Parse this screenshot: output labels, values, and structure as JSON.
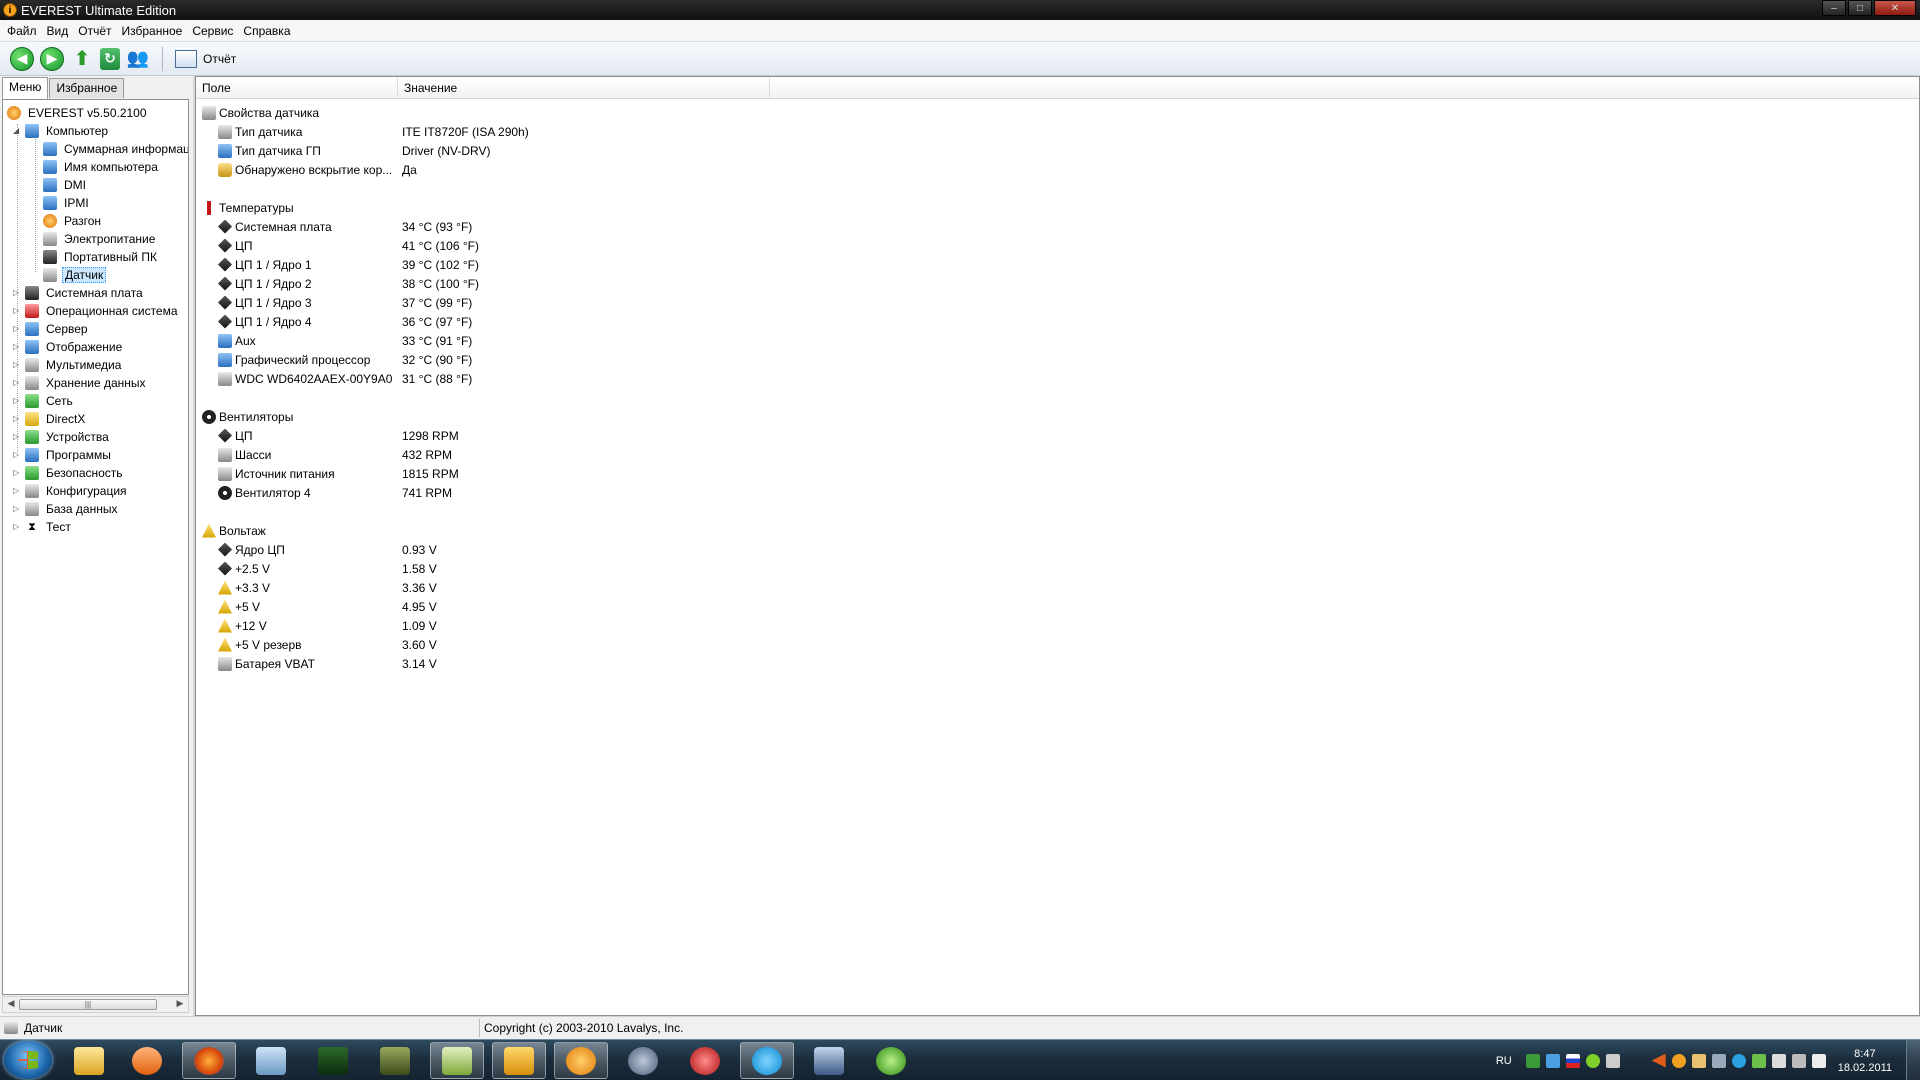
{
  "window": {
    "title": "EVEREST Ultimate Edition",
    "controls": {
      "minimize": "–",
      "maximize": "□",
      "close": "✕"
    }
  },
  "menu": [
    "Файл",
    "Вид",
    "Отчёт",
    "Избранное",
    "Сервис",
    "Справка"
  ],
  "toolbar": {
    "report_label": "Отчёт"
  },
  "left_tabs": [
    "Меню",
    "Избранное"
  ],
  "tree": {
    "root": "EVEREST v5.50.2100",
    "computer": "Компьютер",
    "computer_children": [
      "Суммарная информация",
      "Имя компьютера",
      "DMI",
      "IPMI",
      "Разгон",
      "Электропитание",
      "Портативный ПК",
      "Датчик"
    ],
    "categories": [
      "Системная плата",
      "Операционная система",
      "Сервер",
      "Отображение",
      "Мультимедиа",
      "Хранение данных",
      "Сеть",
      "DirectX",
      "Устройства",
      "Программы",
      "Безопасность",
      "Конфигурация",
      "База данных",
      "Тест"
    ]
  },
  "columns": {
    "field": "Поле",
    "value": "Значение"
  },
  "sections": {
    "sensor_props": {
      "title": "Свойства датчика",
      "rows": [
        {
          "field": "Тип датчика",
          "value": "ITE IT8720F  (ISA 290h)"
        },
        {
          "field": "Тип датчика ГП",
          "value": "Driver  (NV-DRV)"
        },
        {
          "field": "Обнаружено вскрытие кор...",
          "value": "Да"
        }
      ]
    },
    "temps": {
      "title": "Температуры",
      "rows": [
        {
          "field": "Системная плата",
          "value": "34 °C  (93 °F)"
        },
        {
          "field": "ЦП",
          "value": "41 °C  (106 °F)"
        },
        {
          "field": "ЦП 1 / Ядро 1",
          "value": "39 °C  (102 °F)"
        },
        {
          "field": "ЦП 1 / Ядро 2",
          "value": "38 °C  (100 °F)"
        },
        {
          "field": "ЦП 1 / Ядро 3",
          "value": "37 °C  (99 °F)"
        },
        {
          "field": "ЦП 1 / Ядро 4",
          "value": "36 °C  (97 °F)"
        },
        {
          "field": "Aux",
          "value": "33 °C  (91 °F)"
        },
        {
          "field": "Графический процессор",
          "value": "32 °C  (90 °F)"
        },
        {
          "field": "WDC WD6402AAEX-00Y9A0",
          "value": "31 °C  (88 °F)"
        }
      ]
    },
    "fans": {
      "title": "Вентиляторы",
      "rows": [
        {
          "field": "ЦП",
          "value": "1298 RPM"
        },
        {
          "field": "Шасси",
          "value": "432 RPM"
        },
        {
          "field": "Источник питания",
          "value": "1815 RPM"
        },
        {
          "field": "Вентилятор 4",
          "value": "741 RPM"
        }
      ]
    },
    "voltages": {
      "title": "Вольтаж",
      "rows": [
        {
          "field": "Ядро ЦП",
          "value": "0.93 V"
        },
        {
          "field": "+2.5 V",
          "value": "1.58 V"
        },
        {
          "field": "+3.3 V",
          "value": "3.36 V"
        },
        {
          "field": "+5 V",
          "value": "4.95 V"
        },
        {
          "field": "+12 V",
          "value": "1.09 V"
        },
        {
          "field": "+5 V резерв",
          "value": "3.60 V"
        },
        {
          "field": "Батарея VBAT",
          "value": "3.14 V"
        }
      ]
    }
  },
  "status": {
    "left": "Датчик",
    "right": "Copyright (c) 2003-2010 Lavalys, Inc."
  },
  "taskbar": {
    "lang": "RU",
    "time": "8:47",
    "date": "18.02.2011"
  }
}
